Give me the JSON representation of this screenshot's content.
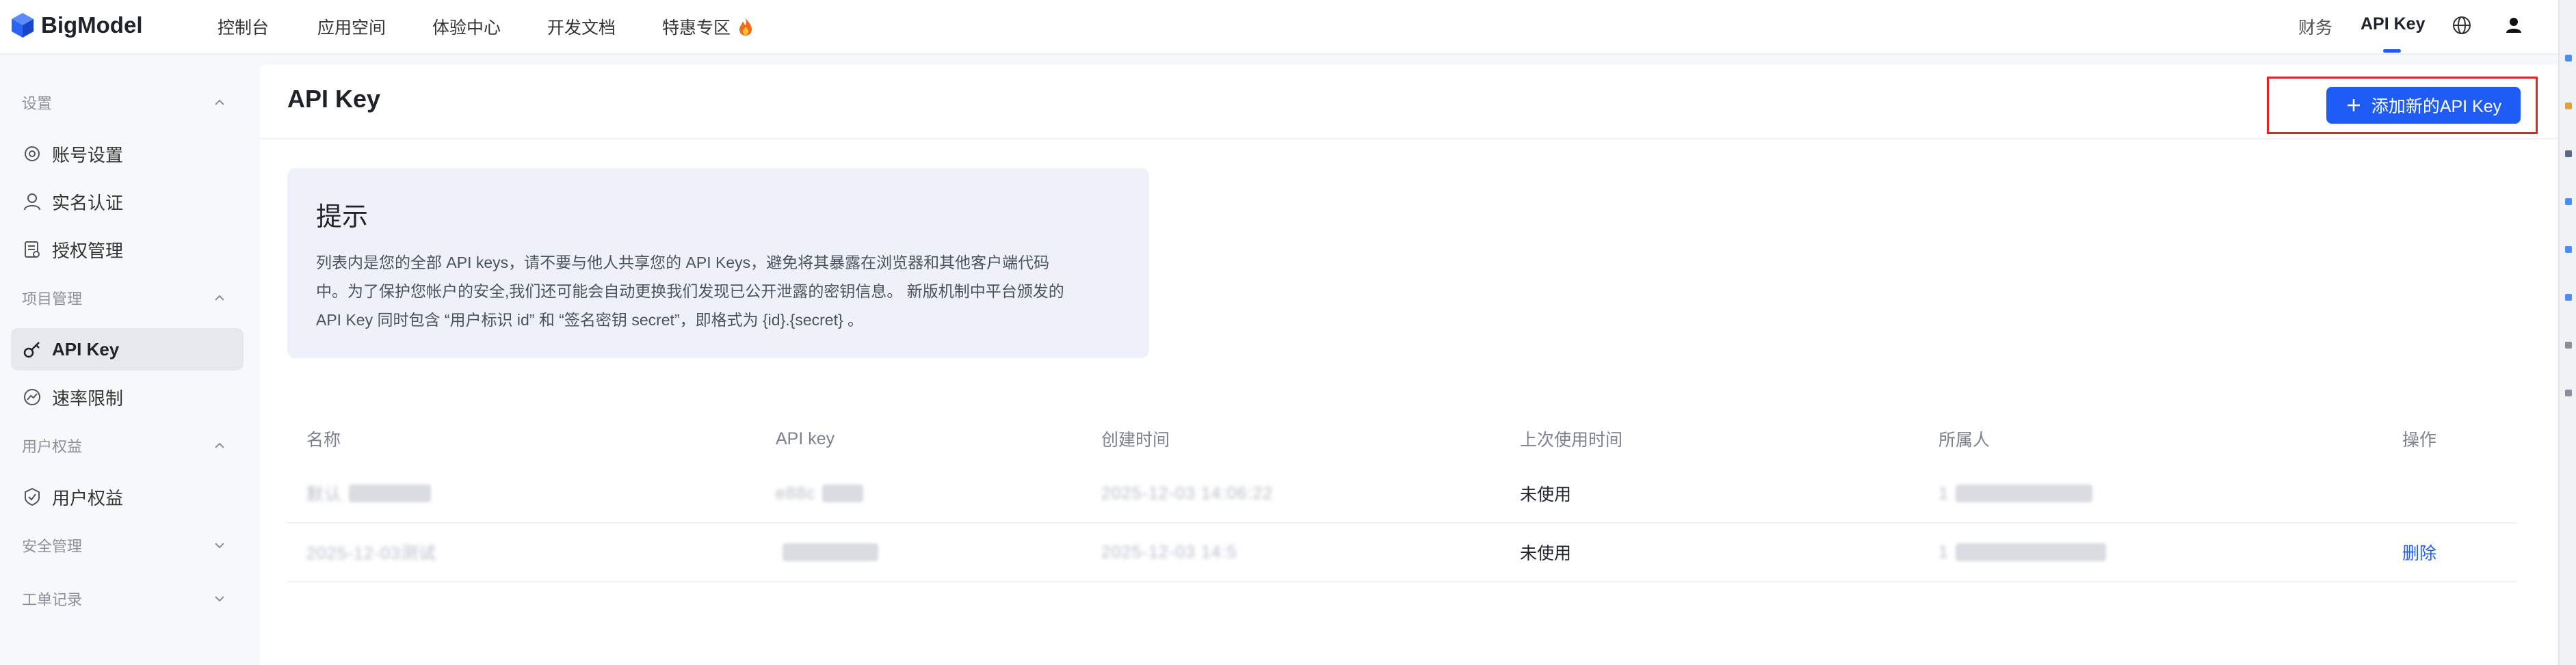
{
  "brand": {
    "name": "BigModel"
  },
  "topnav": {
    "items": [
      "控制台",
      "应用空间",
      "体验中心",
      "开发文档",
      "特惠专区"
    ],
    "right": {
      "finance": "财务",
      "api_key": "API Key"
    }
  },
  "sidebar": {
    "groups": [
      {
        "title": "设置",
        "expanded": true,
        "items": [
          "账号设置",
          "实名认证",
          "授权管理"
        ]
      },
      {
        "title": "项目管理",
        "expanded": true,
        "items": [
          "API Key",
          "速率限制"
        ]
      },
      {
        "title": "用户权益",
        "expanded": true,
        "items": [
          "用户权益"
        ]
      },
      {
        "title": "安全管理",
        "expanded": false,
        "items": []
      },
      {
        "title": "工单记录",
        "expanded": false,
        "items": []
      }
    ],
    "active_item": "API Key"
  },
  "main": {
    "title": "API Key",
    "add_button": "添加新的API Key",
    "tip": {
      "title": "提示",
      "line1": "列表内是您的全部 API keys，请不要与他人共享您的 API Keys，避免将其暴露在浏览器和其他客户端代码",
      "line2": "中。为了保护您帐户的安全,我们还可能会自动更换我们发现已公开泄露的密钥信息。 新版机制中平台颁发的",
      "line3": "API Key 同时包含 “用户标识 id” 和 “签名密钥 secret”，即格式为 {id}.{secret} 。"
    }
  },
  "table": {
    "headers": [
      "名称",
      "API key",
      "创建时间",
      "上次使用时间",
      "所属人",
      "操作"
    ],
    "rows": [
      {
        "name": "默认",
        "api_key": "e88c",
        "created": "2025-12-03 14:06:22",
        "last_used": "未使用",
        "owner": "1",
        "action": ""
      },
      {
        "name": "2025-12-03测试",
        "api_key": "",
        "created": "2025-12-03 14:5",
        "last_used": "未使用",
        "owner": "1",
        "action": "删除"
      }
    ]
  },
  "colors": {
    "primary": "#1f5cf6",
    "highlight_border": "#e02424",
    "tip_bg": "#eef1fa"
  }
}
